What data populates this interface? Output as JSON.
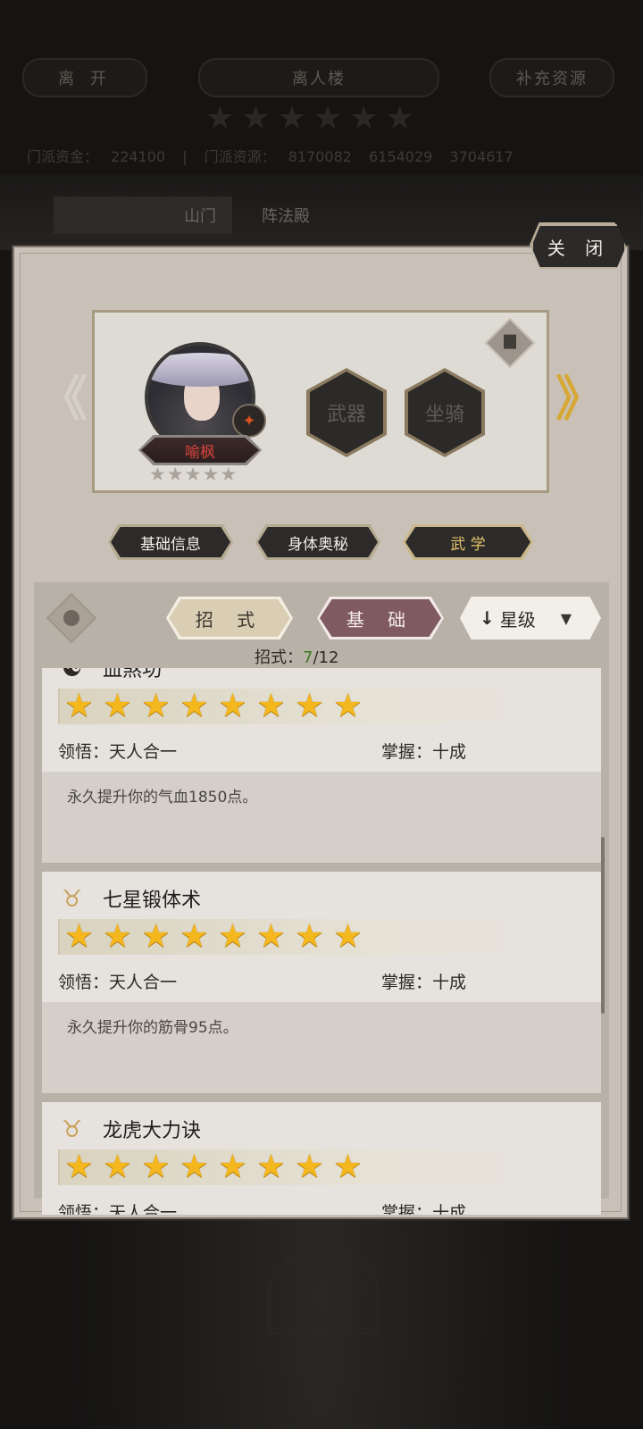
{
  "topbar": {
    "leave_label": "离 开",
    "title": "离人楼",
    "supply_label": "补充资源",
    "stars": [
      "★",
      "★",
      "★",
      "★",
      "★",
      "★"
    ],
    "funds_label": "门派资金：",
    "funds_value": "224100",
    "resources_label": "门派资源：",
    "resources_value": "8170082",
    "res2_value": "6154029",
    "res3_value": "3704617"
  },
  "scene": {
    "tab_shanmen": "山门",
    "tab_zhenfa": "阵法殿"
  },
  "modal": {
    "close_label": "关 闭"
  },
  "character": {
    "name": "喻枫",
    "rank_stars": [
      "★",
      "★",
      "★",
      "★",
      "★"
    ],
    "weapon_slot": "武器",
    "mount_slot": "坐骑",
    "prev_arrow": "《",
    "next_arrow": "》"
  },
  "tabs": [
    {
      "label": "基础信息"
    },
    {
      "label": "身体奥秘"
    },
    {
      "label": "武  学"
    }
  ],
  "filters": {
    "moves_label": "招 式",
    "basic_label": "基 础",
    "sort_label": "星级",
    "sort_arrow": "↓",
    "count_prefix": "招式：",
    "count_current": "7",
    "count_total": "/12"
  },
  "skills": [
    {
      "name": "血煞功",
      "icon": "taiji-icon",
      "stars": 8,
      "comprehension_label": "领悟：",
      "comprehension_value": "天人合一",
      "mastery_label": "掌握：",
      "mastery_value": "十成",
      "description": "永久提升你的气血1850点。"
    },
    {
      "name": "七星锻体术",
      "icon": "ox-head-icon",
      "stars": 8,
      "comprehension_label": "领悟：",
      "comprehension_value": "天人合一",
      "mastery_label": "掌握：",
      "mastery_value": "十成",
      "description": "永久提升你的筋骨95点。"
    },
    {
      "name": "龙虎大力诀",
      "icon": "ox-head-icon",
      "stars": 8,
      "comprehension_label": "领悟：",
      "comprehension_value": "天人合一",
      "mastery_label": "掌握：",
      "mastery_value": "十成",
      "description": ""
    }
  ],
  "colors": {
    "star_gold": "#f4b71e",
    "name_red": "#d8453e",
    "count_green": "#3e7d22",
    "basic_tab": "#7f5a60",
    "moves_tab": "#d9cdb3"
  }
}
